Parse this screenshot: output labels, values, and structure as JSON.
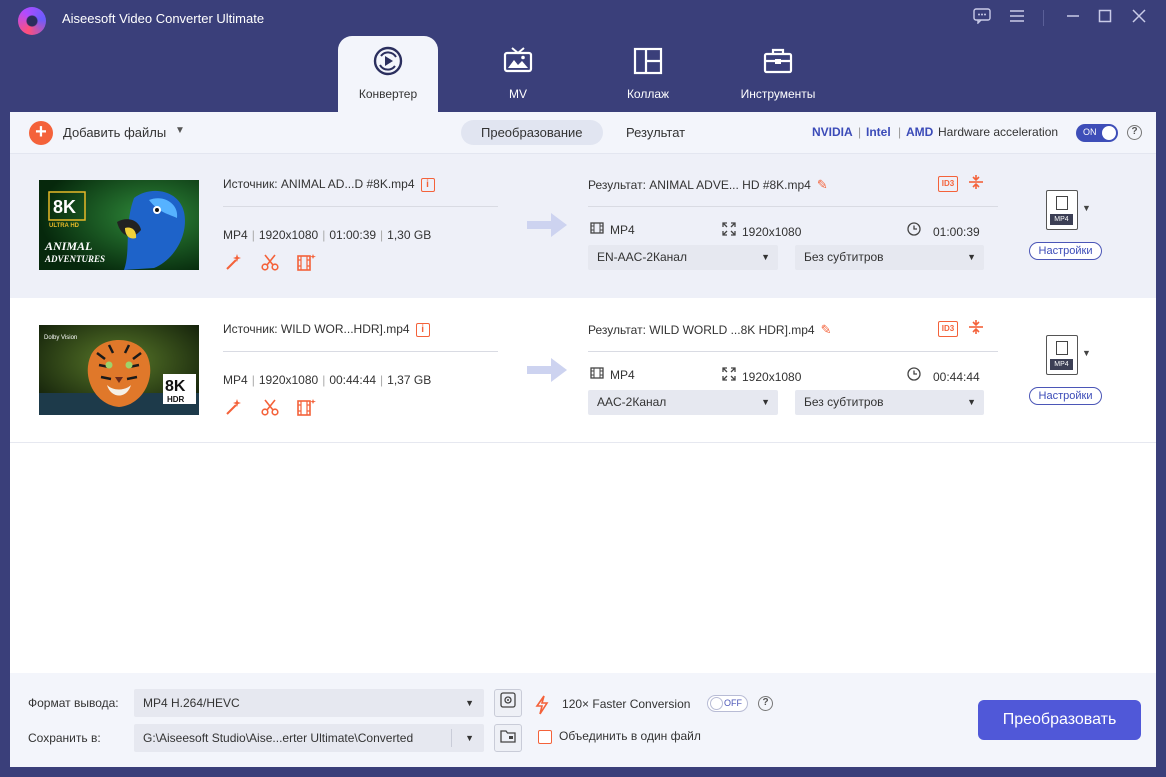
{
  "app": {
    "title": "Aiseesoft Video Converter Ultimate",
    "window_controls": [
      "feedback-icon",
      "menu-icon",
      "minimize-icon",
      "maximize-icon",
      "close-icon"
    ]
  },
  "tabs": [
    {
      "label": "Конвертер",
      "icon": "converter-icon",
      "active": true
    },
    {
      "label": "MV",
      "icon": "mv-icon",
      "active": false
    },
    {
      "label": "Коллаж",
      "icon": "collage-icon",
      "active": false
    },
    {
      "label": "Инструменты",
      "icon": "toolbox-icon",
      "active": false
    }
  ],
  "toolbar": {
    "add_files_label": "Добавить файлы",
    "segments": [
      {
        "label": "Преобразование",
        "active": true
      },
      {
        "label": "Результат",
        "active": false
      }
    ],
    "hw": {
      "nvidia": "NVIDIA",
      "intel": "Intel",
      "amd": "AMD",
      "label": "Hardware acceleration",
      "toggle": "ON"
    }
  },
  "files": [
    {
      "source": "Источник: ANIMAL AD...D #8K.mp4",
      "format": "MP4",
      "resolution": "1920x1080",
      "duration": "01:00:39",
      "size": "1,30 GB",
      "result": "Результат: ANIMAL ADVE... HD #8K.mp4",
      "out_format": "MP4",
      "out_resolution": "1920x1080",
      "out_duration": "01:00:39",
      "audio": "EN-AAC-2Канал",
      "subtitles": "Без субтитров",
      "format_badge": "MP4",
      "settings_label": "Настройки",
      "thumb": {
        "badge": "8K",
        "sub": "ULTRA HD",
        "title_line1": "ANIMAL",
        "title_line2": "ADVENTURES"
      }
    },
    {
      "source": "Источник: WILD WOR...HDR].mp4",
      "format": "MP4",
      "resolution": "1920x1080",
      "duration": "00:44:44",
      "size": "1,37 GB",
      "result": "Результат: WILD WORLD ...8K HDR].mp4",
      "out_format": "MP4",
      "out_resolution": "1920x1080",
      "out_duration": "00:44:44",
      "audio": "AAC-2Канал",
      "subtitles": "Без субтитров",
      "format_badge": "MP4",
      "settings_label": "Настройки",
      "thumb": {
        "badge": "8K",
        "sub": "HDR",
        "corner": "Dolby Vision"
      }
    }
  ],
  "footer": {
    "output_format_label": "Формат вывода:",
    "output_format_value": "MP4 H.264/HEVC",
    "save_to_label": "Сохранить в:",
    "save_to_value": "G:\\Aiseesoft Studio\\Aise...erter Ultimate\\Converted",
    "faster_label": "120× Faster Conversion",
    "faster_toggle": "OFF",
    "merge_label": "Объединить в один файл",
    "convert_label": "Преобразовать"
  },
  "colors": {
    "accent": "#f4623a",
    "primary": "#5058d8",
    "titlebar": "#3a3f7a"
  }
}
